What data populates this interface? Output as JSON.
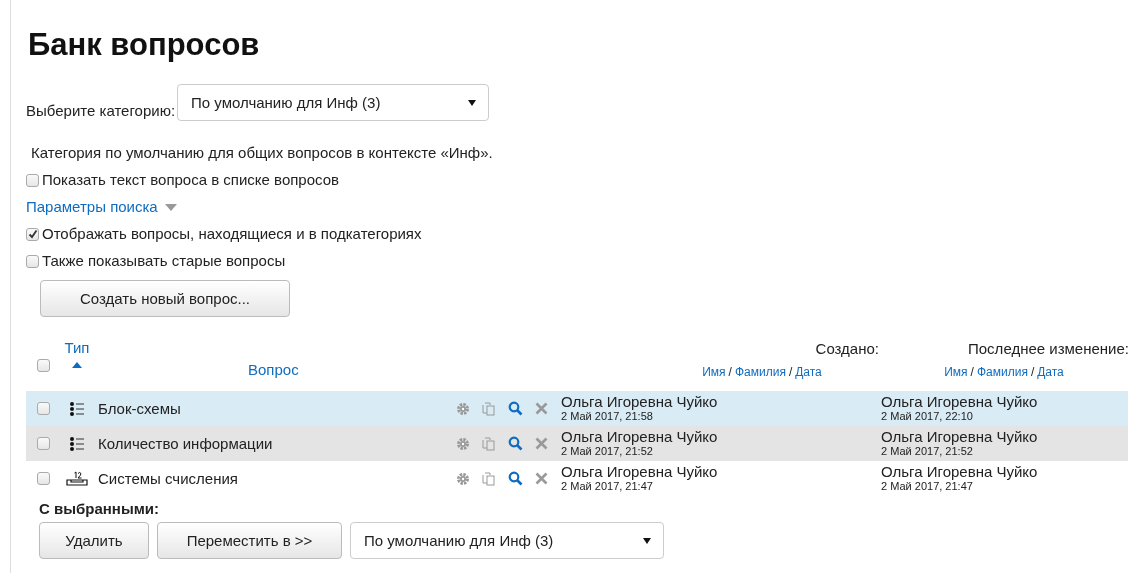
{
  "title": "Банк вопросов",
  "category_select": {
    "label": "Выберите категорию:",
    "value": "По умолчанию для Инф (3)"
  },
  "category_description": "Категория по умолчанию для общих вопросов в контексте «Инф».",
  "show_text_option": {
    "label": "Показать текст вопроса в списке вопросов",
    "checked": false
  },
  "search_options": {
    "label": "Параметры поиска",
    "expanded": false
  },
  "filters": [
    {
      "label": "Отображать вопросы, находящиеся и в подкатегориях",
      "checked": true
    },
    {
      "label": "Также показывать старые вопросы",
      "checked": false
    }
  ],
  "create_button": "Создать новый вопрос...",
  "table": {
    "select_all_checked": false,
    "columns": {
      "type": "Тип",
      "type_sort_ascending": true,
      "question": "Вопрос",
      "created": "Создано:",
      "modified": "Последнее изменение:"
    },
    "created_sort_links": [
      "Имя",
      "/",
      "Фамилия",
      "/",
      "Дата"
    ],
    "modified_sort_links": [
      "Имя",
      "/",
      "Фамилия",
      "/",
      "Дата"
    ],
    "rows": [
      {
        "checked": false,
        "highlighted": true,
        "kind": "multichoice",
        "name": "Блок-схемы",
        "created_by": "Ольга Игоревна Чуйко",
        "created_at": "2 Май 2017, 21:58",
        "modified_by": "Ольга Игоревна Чуйко",
        "modified_at": "2 Май 2017, 22:10"
      },
      {
        "checked": false,
        "highlighted": false,
        "kind": "multichoice",
        "name": "Количество информации",
        "created_by": "Ольга Игоревна Чуйко",
        "created_at": "2 Май 2017, 21:52",
        "modified_by": "Ольга Игоревна Чуйко",
        "modified_at": "2 Май 2017, 21:52"
      },
      {
        "checked": false,
        "highlighted": false,
        "kind": "numerical",
        "name": "Системы счисления",
        "created_by": "Ольга Игоревна Чуйко",
        "created_at": "2 Май 2017, 21:47",
        "modified_by": "Ольга Игоревна Чуйко",
        "modified_at": "2 Май 2017, 21:47"
      }
    ]
  },
  "bulk": {
    "label": "С выбранными:",
    "buttons": [
      "Удалить",
      "Переместить в >>"
    ],
    "target": "По умолчанию для Инф (3)"
  }
}
